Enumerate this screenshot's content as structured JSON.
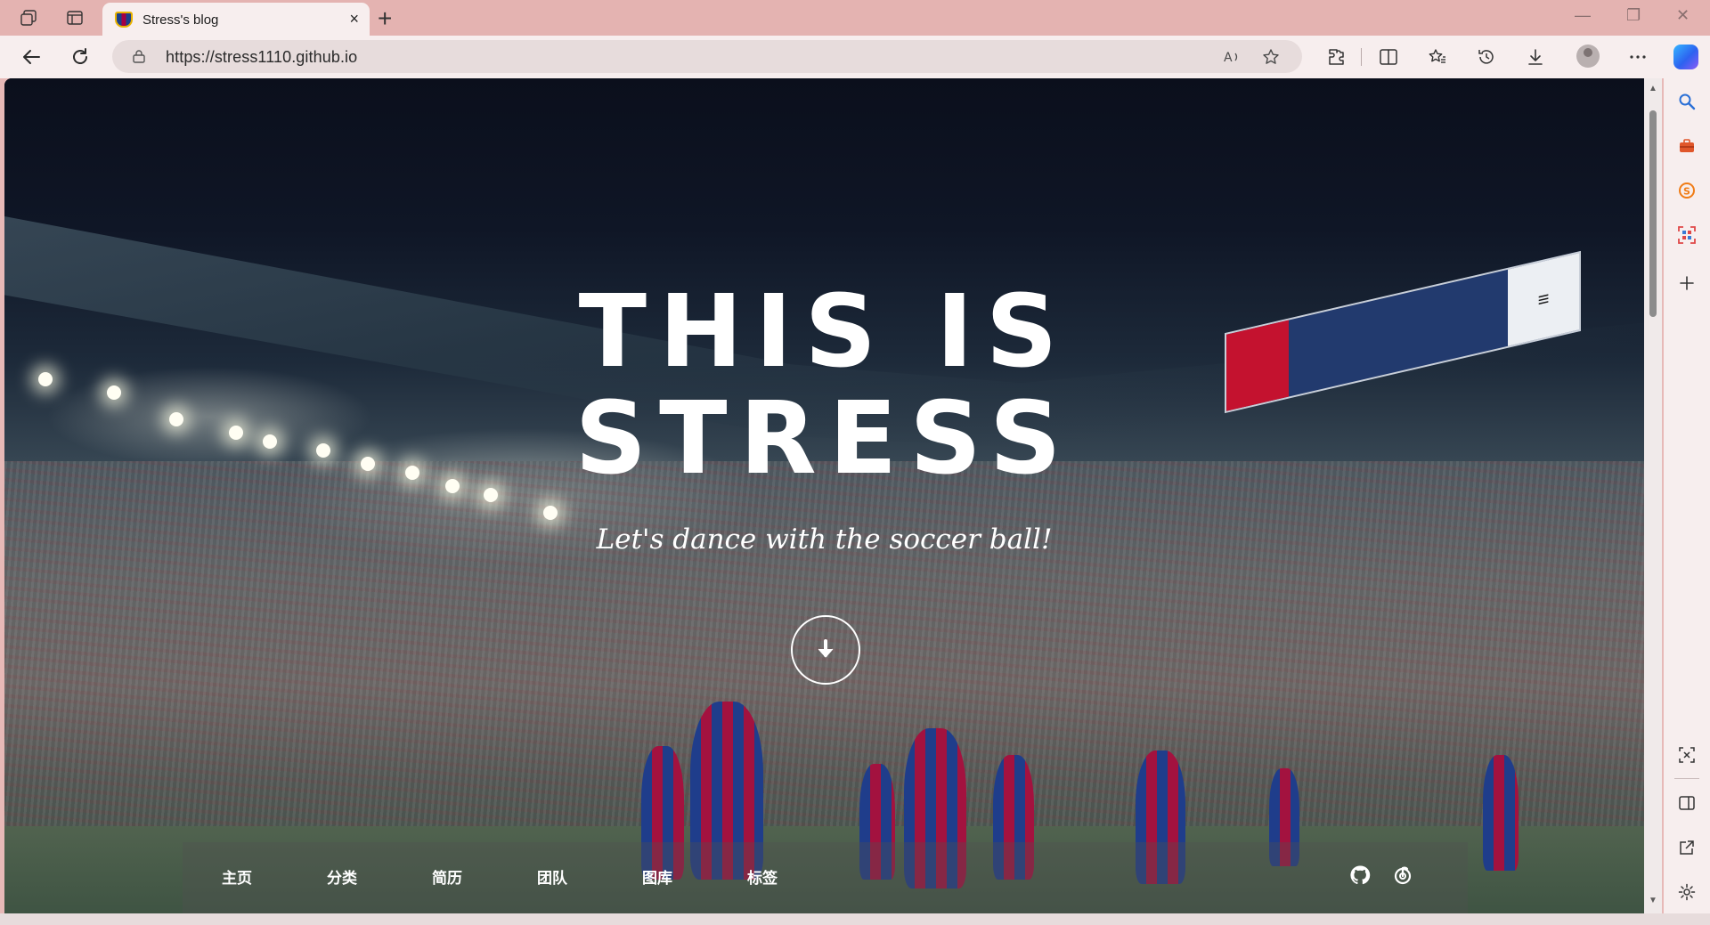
{
  "browser": {
    "tab": {
      "title": "Stress's blog"
    },
    "address": {
      "url": "https://stress1110.github.io"
    },
    "icons": {
      "tab_actions": "tab-actions-icon",
      "vertical_tabs": "vertical-tabs-icon",
      "new_tab": "+",
      "close_tab": "×",
      "minimize": "—",
      "restore": "❐",
      "close_window": "✕"
    }
  },
  "hero": {
    "title_line1": "THIS IS",
    "title_line2": "STRESS",
    "subtitle": "Let's dance with the soccer ball!"
  },
  "site_nav": {
    "items": [
      {
        "label": "主页"
      },
      {
        "label": "分类"
      },
      {
        "label": "简历"
      },
      {
        "label": "团队"
      },
      {
        "label": "图库"
      },
      {
        "label": "标签"
      }
    ],
    "social": [
      "github-icon",
      "netease-music-icon"
    ]
  },
  "colors": {
    "titlebar": "#e4b3b1",
    "toolbar": "#f7eeee",
    "omnibox": "#e7dcdc",
    "accent_blue": "#1f3d8b",
    "accent_red": "#a3123f"
  }
}
